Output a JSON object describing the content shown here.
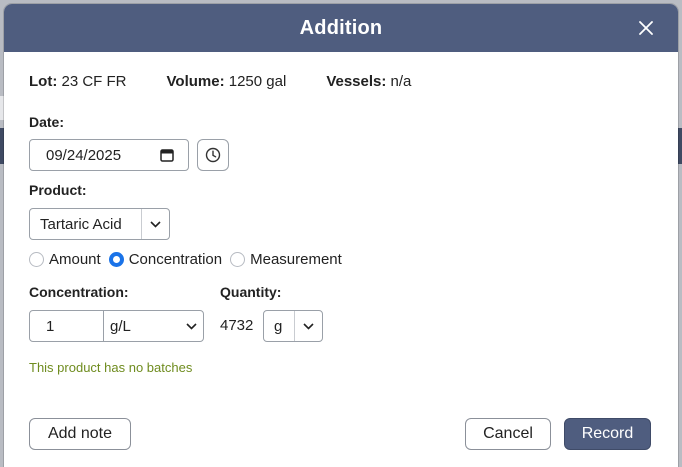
{
  "dialog": {
    "title": "Addition"
  },
  "meta": {
    "lot_label": "Lot:",
    "lot_value": "23 CF FR",
    "volume_label": "Volume:",
    "volume_value": "1250 gal",
    "vessels_label": "Vessels:",
    "vessels_value": "n/a"
  },
  "date": {
    "label": "Date:",
    "value": "09/24/2025"
  },
  "product": {
    "label": "Product:",
    "selected": "Tartaric Acid"
  },
  "mode": {
    "options": [
      {
        "label": "Amount",
        "selected": false
      },
      {
        "label": "Concentration",
        "selected": true
      },
      {
        "label": "Measurement",
        "selected": false
      }
    ]
  },
  "concentration": {
    "label": "Concentration:",
    "value": "1",
    "unit": "g/L"
  },
  "quantity": {
    "label": "Quantity:",
    "value": "4732",
    "unit": "g"
  },
  "notice": "This product has no batches",
  "buttons": {
    "add_note": "Add note",
    "cancel": "Cancel",
    "record": "Record"
  },
  "colors": {
    "header": "#4f5d7f",
    "radio_accent": "#1a73e8",
    "notice": "#6f8c1f"
  },
  "icons": {
    "close": "close-icon",
    "calendar": "calendar-icon",
    "clock": "clock-icon",
    "chevron": "chevron-down-icon"
  }
}
